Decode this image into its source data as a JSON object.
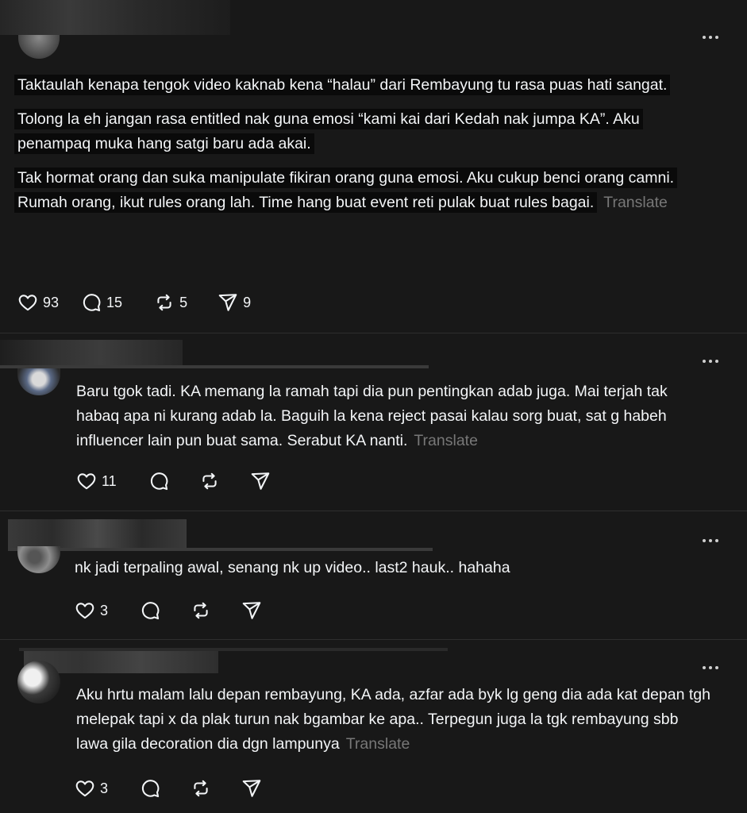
{
  "posts": [
    {
      "paragraphs": [
        "Taktaulah kenapa tengok video kaknab kena “halau” dari Rembayung tu rasa puas hati sangat.",
        "Tolong la eh jangan rasa entitled nak guna emosi “kami kai dari Kedah nak jumpa KA”. Aku penampaq muka hang satgi baru ada akai.",
        "Tak hormat orang dan suka manipulate fikiran orang guna emosi. Aku cukup benci orang camni. Rumah orang, ikut rules orang lah. Time hang buat event reti pulak buat rules bagai."
      ],
      "translate": "Translate",
      "likes": "93",
      "replies": "15",
      "reposts": "5",
      "shares": "9"
    },
    {
      "text": "Baru tgok tadi. KA memang la ramah tapi dia pun pentingkan adab juga. Mai terjah tak habaq apa ni kurang adab la. Baguih la kena reject pasai kalau sorg buat, sat g habeh influencer lain pun buat sama. Serabut KA nanti.",
      "translate": "Translate",
      "likes": "11"
    },
    {
      "text": "nk jadi terpaling awal, senang nk up video.. last2 hauk.. hahaha",
      "likes": "3"
    },
    {
      "text": "Aku hrtu malam lalu depan rembayung, KA ada, azfar ada byk lg geng dia ada kat depan tgh melepak tapi x da plak turun nak bgambar ke apa.. Terpegun juga la tgk rembayung sbb lawa gila decoration dia dgn lampunya",
      "translate": "Translate",
      "likes": "3"
    }
  ],
  "icons": [
    "heart-icon",
    "comment-icon",
    "repost-icon",
    "share-icon",
    "more-icon"
  ],
  "colors": {
    "background": "#181818",
    "text": "#f3f5f7",
    "muted": "#777777",
    "highlight": "#0a0a0a"
  }
}
